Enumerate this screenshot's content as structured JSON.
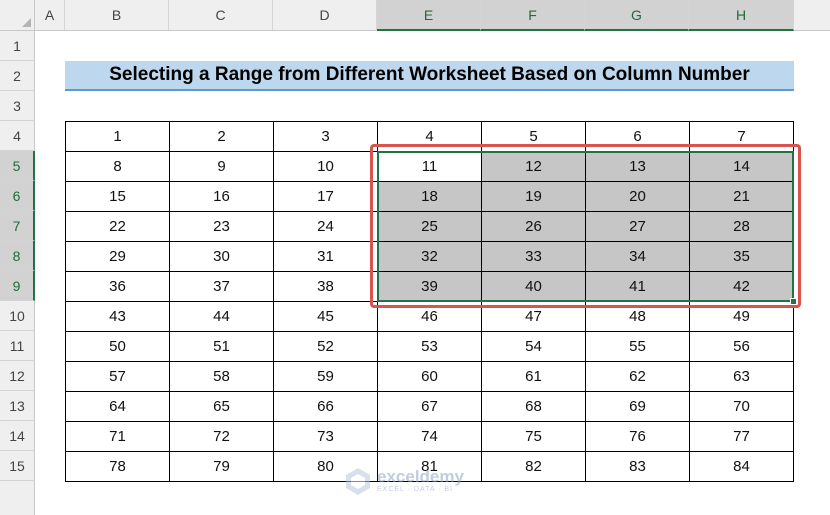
{
  "columns": [
    "A",
    "B",
    "C",
    "D",
    "E",
    "F",
    "G",
    "H"
  ],
  "rows": [
    "1",
    "2",
    "3",
    "4",
    "5",
    "6",
    "7",
    "8",
    "9",
    "10",
    "11",
    "12",
    "13",
    "14",
    "15"
  ],
  "title": "Selecting a Range from Different Worksheet Based on Column Number",
  "table": [
    [
      "1",
      "2",
      "3",
      "4",
      "5",
      "6",
      "7"
    ],
    [
      "8",
      "9",
      "10",
      "11",
      "12",
      "13",
      "14"
    ],
    [
      "15",
      "16",
      "17",
      "18",
      "19",
      "20",
      "21"
    ],
    [
      "22",
      "23",
      "24",
      "25",
      "26",
      "27",
      "28"
    ],
    [
      "29",
      "30",
      "31",
      "32",
      "33",
      "34",
      "35"
    ],
    [
      "36",
      "37",
      "38",
      "39",
      "40",
      "41",
      "42"
    ],
    [
      "43",
      "44",
      "45",
      "46",
      "47",
      "48",
      "49"
    ],
    [
      "50",
      "51",
      "52",
      "53",
      "54",
      "55",
      "56"
    ],
    [
      "57",
      "58",
      "59",
      "60",
      "61",
      "62",
      "63"
    ],
    [
      "64",
      "65",
      "66",
      "67",
      "68",
      "69",
      "70"
    ],
    [
      "71",
      "72",
      "73",
      "74",
      "75",
      "76",
      "77"
    ],
    [
      "78",
      "79",
      "80",
      "81",
      "82",
      "83",
      "84"
    ]
  ],
  "watermark": {
    "name": "exceldemy",
    "tagline": "EXCEL · DATA · BI"
  },
  "colors": {
    "selection": "#217346",
    "highlight": "#c6c6c6",
    "title_bg": "#bdd7ee",
    "callout": "#d9534f"
  }
}
